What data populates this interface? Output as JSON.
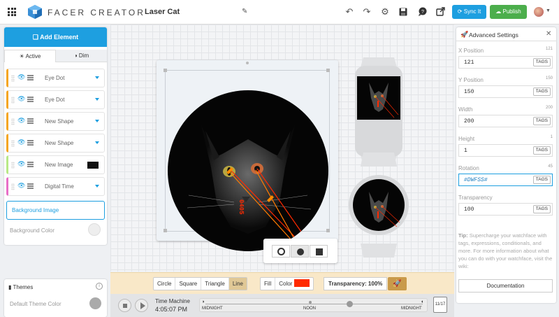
{
  "header": {
    "brand": "FACER CREATOR",
    "project_name": "Laser Cat",
    "sync_label": "Sync It",
    "publish_label": "Publish"
  },
  "left_panel": {
    "add_element_label": "Add Element",
    "tabs": [
      {
        "label": "Active"
      },
      {
        "label": "Dim"
      }
    ],
    "layers": [
      {
        "label": "Eye Dot",
        "color": "#f5a623"
      },
      {
        "label": "Eye Dot",
        "color": "#f5a623"
      },
      {
        "label": "New Shape",
        "color": "#f5a623"
      },
      {
        "label": "New Shape",
        "color": "#f5a623"
      },
      {
        "label": "New Image",
        "color": "#b8e986"
      },
      {
        "label": "Digital Time",
        "color": "#e86ec8"
      }
    ],
    "background_image_label": "Background Image",
    "background_color_label": "Background Color"
  },
  "themes": {
    "title": "Themes",
    "default_color_label": "Default Theme Color"
  },
  "property_bar": {
    "shapes": [
      "Circle",
      "Square",
      "Triangle",
      "Line"
    ],
    "active_shape": "Line",
    "fill_label": "Fill",
    "color_label": "Color",
    "color_value": "#ff2a00",
    "transparency_text": "Transparency: 100%"
  },
  "time_machine": {
    "title": "Time Machine",
    "time": "4:05:07 PM",
    "labels": [
      "MIDNIGHT",
      "NOON",
      "MIDNIGHT"
    ],
    "calendar_date": "11/17"
  },
  "advanced": {
    "title": "Advanced Settings",
    "fields": [
      {
        "label": "X Position",
        "hint": "121",
        "value": "121"
      },
      {
        "label": "Y Position",
        "hint": "150",
        "value": "150"
      },
      {
        "label": "Width",
        "hint": "200",
        "value": "200"
      },
      {
        "label": "Height",
        "hint": "1",
        "value": "1"
      },
      {
        "label": "Rotation",
        "hint": "45",
        "value": "#DWFSS#"
      },
      {
        "label": "Transparency",
        "hint": "",
        "value": "100"
      }
    ],
    "tags_label": "TAGS",
    "tip_bold": "Tip:",
    "tip_text": "Supercharge your watchface with tags, expressions, conditionals, and more. For more information about what you can do with your watchface, visit the wiki:",
    "documentation_label": "Documentation"
  },
  "watchface": {
    "time_text": "0405"
  },
  "colors": {
    "accent": "#1e9fe0",
    "publish": "#4cae4c",
    "laser": "#ff2a00",
    "laser_beam_orange": "#ff7a00"
  }
}
